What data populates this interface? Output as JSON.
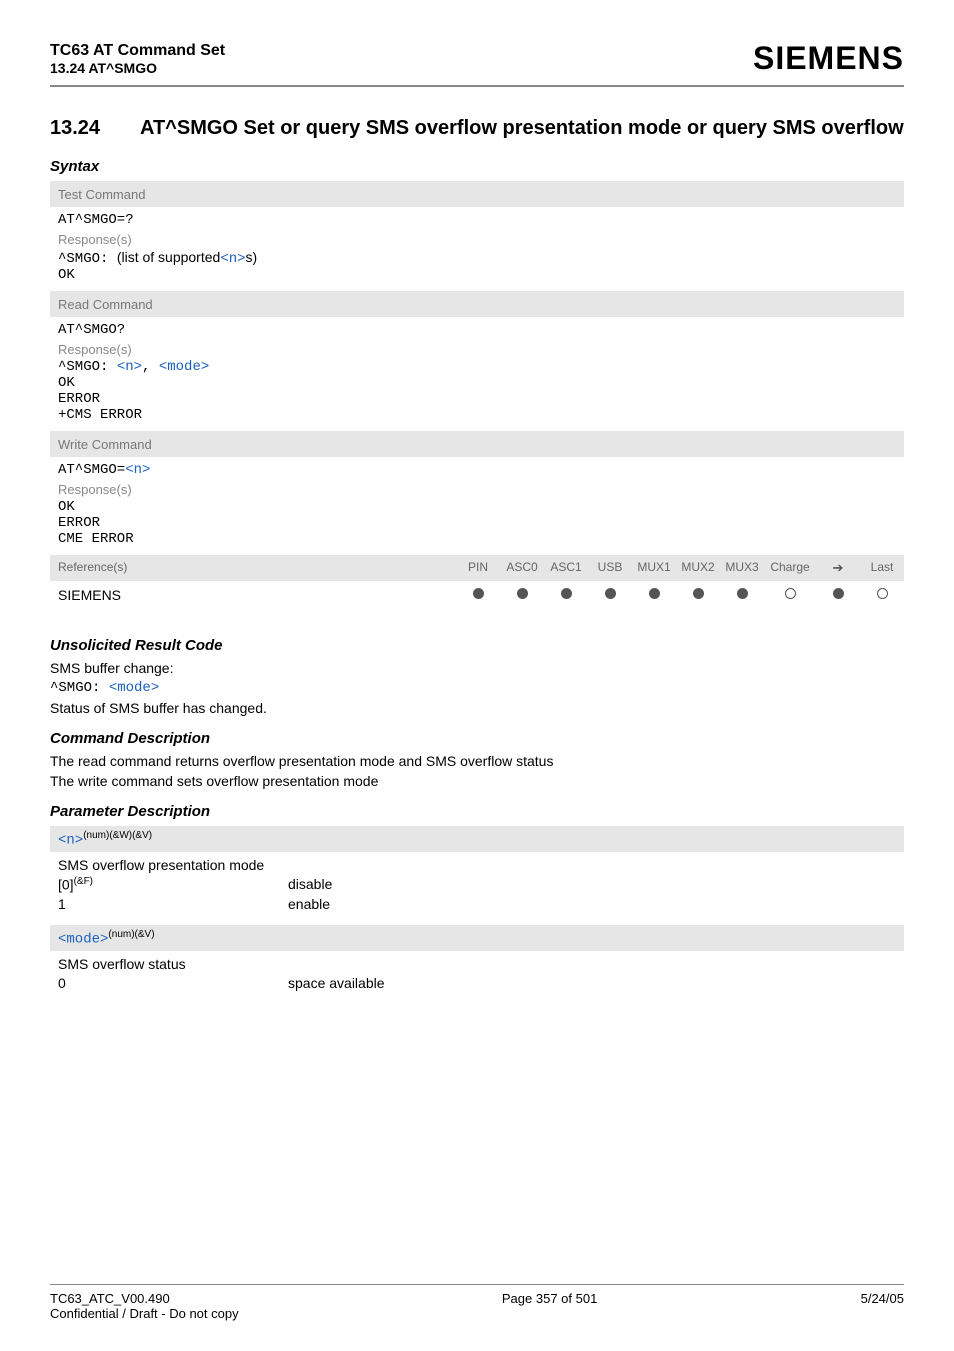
{
  "header": {
    "title": "TC63 AT Command Set",
    "subtitle": "13.24 AT^SMGO",
    "logo": "SIEMENS"
  },
  "section": {
    "number": "13.24",
    "title": "AT^SMGO   Set or query SMS overflow presentation mode or query SMS overflow"
  },
  "syntax_label": "Syntax",
  "test": {
    "head": "Test Command",
    "cmd": "AT^SMGO=?",
    "resp_label": "Response(s)",
    "resp_prefix": "^SMGO: ",
    "resp_text": "(list of supported",
    "resp_param": "<n>",
    "resp_suffix": "s)",
    "ok": "OK"
  },
  "read": {
    "head": "Read Command",
    "cmd": "AT^SMGO?",
    "resp_label": "Response(s)",
    "resp_prefix": "^SMGO: ",
    "p1": "<n>",
    "comma": ", ",
    "p2": "<mode>",
    "ok": "OK",
    "err": "ERROR",
    "cms": "+CMS ERROR"
  },
  "write": {
    "head": "Write Command",
    "cmd_prefix": "AT^SMGO=",
    "cmd_param": "<n>",
    "resp_label": "Response(s)",
    "ok": "OK",
    "err": "ERROR",
    "cme": "CME ERROR"
  },
  "ref": {
    "label": "Reference(s)",
    "cols": [
      "PIN",
      "ASC0",
      "ASC1",
      "USB",
      "MUX1",
      "MUX2",
      "MUX3",
      "Charge",
      "➔",
      "Last"
    ],
    "value": "SIEMENS",
    "dots": [
      "fill",
      "fill",
      "fill",
      "fill",
      "fill",
      "fill",
      "fill",
      "open",
      "fill",
      "open"
    ]
  },
  "urc": {
    "heading": "Unsolicited Result Code",
    "line1": "SMS buffer change:",
    "prefix": "^SMGO: ",
    "param": "<mode>",
    "line2": "Status of SMS buffer has changed."
  },
  "cmd_desc": {
    "heading": "Command Description",
    "l1": "The read command returns overflow presentation mode and SMS overflow status",
    "l2": "The write command sets overflow presentation mode"
  },
  "param_desc_heading": "Parameter Description",
  "param_n": {
    "name": "<n>",
    "sup": "(num)(&W)(&V)",
    "desc": "SMS overflow presentation mode",
    "row1_k": "[0]",
    "row1_sup": "(&F)",
    "row1_v": "disable",
    "row2_k": "1",
    "row2_v": "enable"
  },
  "param_mode": {
    "name": "<mode>",
    "sup": "(num)(&V)",
    "desc": "SMS overflow status",
    "row1_k": "0",
    "row1_v": "space available"
  },
  "footer": {
    "l1": "TC63_ATC_V00.490",
    "l2": "Confidential / Draft - Do not copy",
    "c": "Page 357 of 501",
    "r": "5/24/05"
  }
}
